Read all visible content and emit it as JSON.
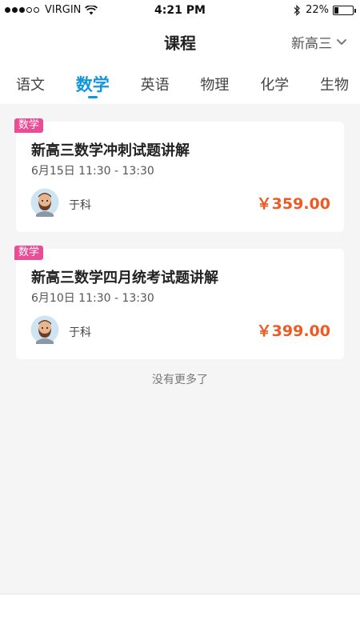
{
  "status_bar": {
    "carrier": "VIRGIN",
    "time": "4:21 PM",
    "battery_pct": "22%",
    "battery_level": 0.22
  },
  "header": {
    "title": "课程",
    "grade": "新高三"
  },
  "tabs": [
    {
      "label": "语文"
    },
    {
      "label": "数学"
    },
    {
      "label": "英语"
    },
    {
      "label": "物理"
    },
    {
      "label": "化学"
    },
    {
      "label": "生物"
    }
  ],
  "active_tab": "数学",
  "courses": [
    {
      "tag": "数学",
      "title": "新高三数学冲刺试题讲解",
      "time": "6月15日 11:30 - 13:30",
      "teacher": "于科",
      "price": "￥359.00"
    },
    {
      "tag": "数学",
      "title": "新高三数学四月统考试题讲解",
      "time": "6月10日 11:30 - 13:30",
      "teacher": "于科",
      "price": "￥399.00"
    }
  ],
  "footer_text": "没有更多了",
  "colors": {
    "accent": "#1296db",
    "tag": "#ea4d95",
    "price": "#ef5a22",
    "background": "#f5f5f5"
  }
}
